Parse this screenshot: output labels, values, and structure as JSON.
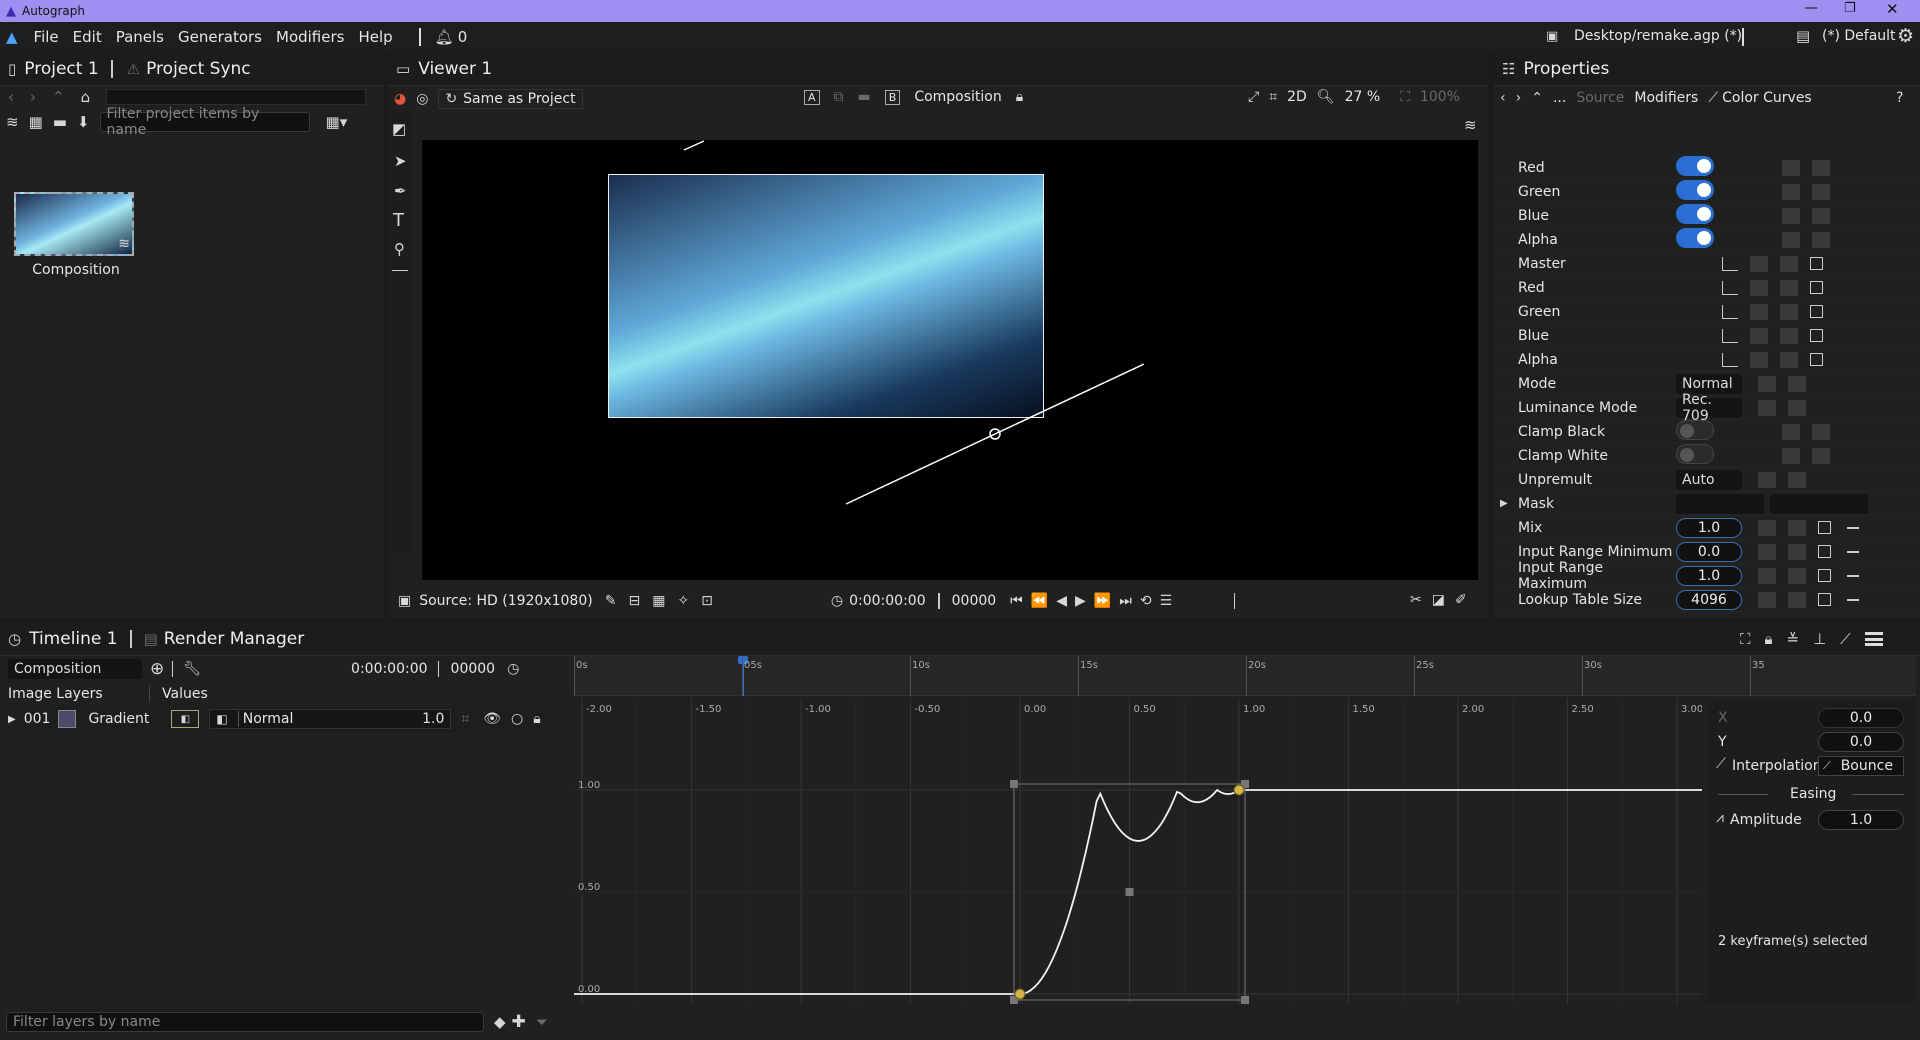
{
  "app": {
    "title": "Autograph"
  },
  "menu": [
    "File",
    "Edit",
    "Panels",
    "Generators",
    "Modifiers",
    "Help"
  ],
  "notifications": "0",
  "project_file": "Desktop/remake.agp (*)",
  "workspace": "(*) Default",
  "project_panel": {
    "tab": "Project 1",
    "tab2": "Project Sync",
    "filter_placeholder": "Filter project items by name",
    "item": "Composition"
  },
  "viewer": {
    "title": "Viewer 1",
    "color_space": "Same as Project",
    "comp_btn_a": "A",
    "comp_btn_b": "B",
    "composition": "Composition",
    "mode_2d": "2D",
    "zoom": "27 %",
    "zoom_fit": "100%",
    "source": "Source: HD (1920x1080)",
    "timecode": "0:00:00:00",
    "frame": "00000"
  },
  "properties": {
    "title": "Properties",
    "breadcrumb": [
      "...",
      "Source",
      "Modifiers",
      "Color Curves"
    ],
    "rows": [
      {
        "label": "Red",
        "kind": "toggle",
        "on": true
      },
      {
        "label": "Green",
        "kind": "toggle",
        "on": true
      },
      {
        "label": "Blue",
        "kind": "toggle",
        "on": true
      },
      {
        "label": "Alpha",
        "kind": "toggle",
        "on": true
      },
      {
        "label": "Master",
        "kind": "curve"
      },
      {
        "label": "Red",
        "kind": "curve"
      },
      {
        "label": "Green",
        "kind": "curve"
      },
      {
        "label": "Blue",
        "kind": "curve"
      },
      {
        "label": "Alpha",
        "kind": "curve"
      },
      {
        "label": "Mode",
        "kind": "select",
        "value": "Normal"
      },
      {
        "label": "Luminance Mode",
        "kind": "select",
        "value": "Rec. 709"
      },
      {
        "label": "Clamp Black",
        "kind": "toggle",
        "on": false
      },
      {
        "label": "Clamp White",
        "kind": "toggle",
        "on": false
      },
      {
        "label": "Unpremult",
        "kind": "select",
        "value": "Auto"
      },
      {
        "label": "Mask",
        "kind": "mask"
      },
      {
        "label": "Mix",
        "kind": "number",
        "value": "1.0"
      },
      {
        "label": "Input Range Minimum",
        "kind": "number",
        "value": "0.0"
      },
      {
        "label": "Input Range Maximum",
        "kind": "number",
        "value": "1.0"
      },
      {
        "label": "Lookup Table Size",
        "kind": "number",
        "value": "4096"
      }
    ]
  },
  "timeline": {
    "tab": "Timeline 1",
    "tab2": "Render Manager",
    "composition": "Composition",
    "timecode": "0:00:00:00",
    "frame": "00000",
    "col_layers": "Image Layers",
    "col_values": "Values",
    "layer": {
      "index": "001",
      "name": "Gradient",
      "blend": "Normal",
      "opacity": "1.0"
    },
    "ruler": [
      "0s",
      "05s",
      "10s",
      "15s",
      "20s",
      "25s",
      "30s",
      "35"
    ],
    "graph_x": [
      "-2.00",
      "-1.50",
      "-1.00",
      "-0.50",
      "0.00",
      "0.50",
      "1.00",
      "1.50",
      "2.00",
      "2.50",
      "3.00"
    ],
    "graph_y": [
      "1.00",
      "0.50",
      "0.00"
    ],
    "filter_placeholder": "Filter layers by name"
  },
  "keyframe_panel": {
    "x_label": "X",
    "x_value": "0.0",
    "y_label": "Y",
    "y_value": "0.0",
    "interp_label": "Interpolation",
    "interp_value": "Bounce",
    "easing_label": "Easing",
    "amp_label": "Amplitude",
    "amp_value": "1.0",
    "status": "2 keyframe(s) selected"
  },
  "colors": {
    "accent": "#3b82f6",
    "keyframe": "#d4b34a",
    "titlebar": "#9f8ff0"
  }
}
